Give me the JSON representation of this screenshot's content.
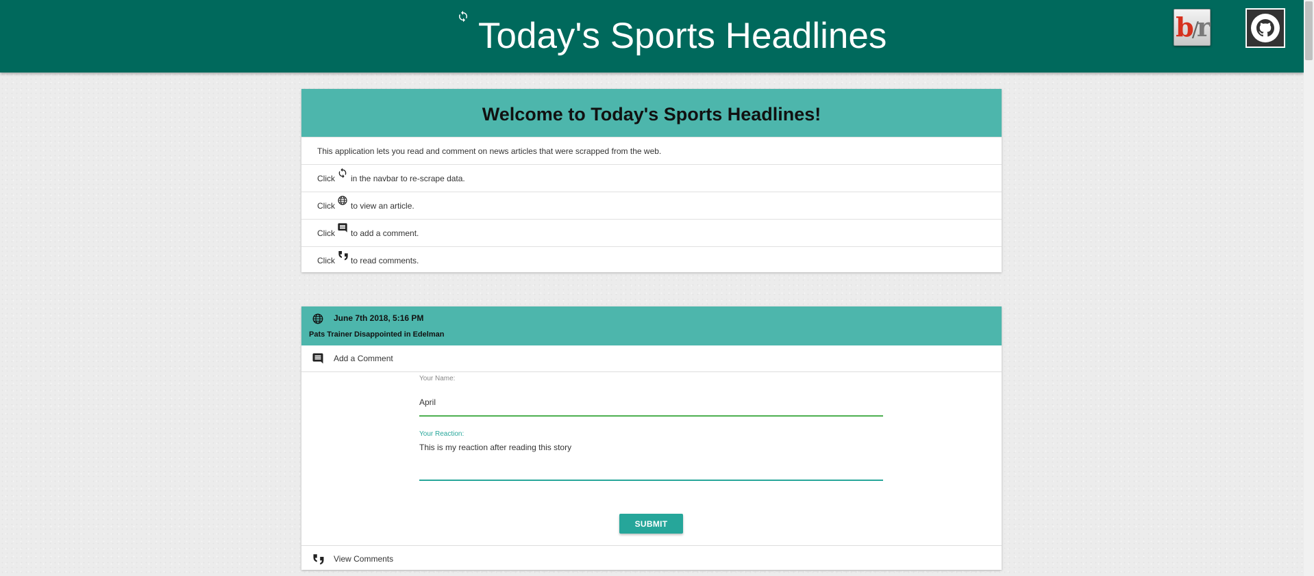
{
  "navbar": {
    "title": "Today's Sports Headlines",
    "refresh_icon": "refresh-icon",
    "logos": {
      "bleacher_report": {
        "b": "b",
        "slash": "/",
        "r": "r"
      },
      "github": "github-icon"
    }
  },
  "welcome": {
    "heading": "Welcome to Today's Sports Headlines!",
    "intro": "This application lets you read and comment on news articles that were scrapped from the web.",
    "rows": [
      {
        "pre": "Click",
        "icon": "refresh-icon",
        "post": "in the navbar to re-scrape data."
      },
      {
        "pre": "Click",
        "icon": "globe-icon",
        "post": "to view an article."
      },
      {
        "pre": "Click",
        "icon": "comment-icon",
        "post": "to add a comment."
      },
      {
        "pre": "Click",
        "icon": "quote-icon",
        "post": "to read comments."
      }
    ]
  },
  "article": {
    "date": "June 7th 2018, 5:16 PM",
    "title": "Pats Trainer Disappointed in Edelman",
    "add_comment_label": "Add a Comment",
    "form": {
      "name_label": "Your Name:",
      "name_value": "April",
      "reaction_label": "Your Reaction:",
      "reaction_value": "This is my reaction after reading this story",
      "submit_label": "SUBMIT"
    },
    "view_comments_label": "View Comments"
  },
  "colors": {
    "navbar": "#00695c",
    "card_header": "#4db6ac",
    "accent": "#26a69a",
    "name_underline": "#4caf50"
  }
}
